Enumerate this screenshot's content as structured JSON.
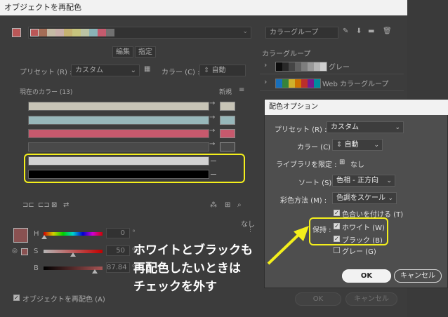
{
  "window": {
    "title": "オブジェクトを再配色"
  },
  "toolbar": {
    "harmony_group_placeholder": "カラーグループ",
    "harmony_colors": [
      "#e36b6b",
      "#c9866a",
      "#f1e3c8",
      "#f7d6cf",
      "#f2d98a",
      "#f3f09a",
      "#e6f0c8",
      "#a9dbe0",
      "#f06f87",
      "#8a8a8a"
    ]
  },
  "tabs": {
    "edit": "編集",
    "assign": "指定"
  },
  "preset": {
    "label": "プリセット (R) :",
    "value": "カスタム"
  },
  "colors_count": {
    "label": "カラー (C) :",
    "value": "自動"
  },
  "current_colors": {
    "header": "現在のカラー (13)",
    "new_header": "新規",
    "rows": [
      {
        "current": "#f3efdf",
        "new": "#f3efdf",
        "has_new": true
      },
      {
        "current": "#b9e0e3",
        "new": "#b9e0e3",
        "has_new": true
      },
      {
        "current": "#f36d86",
        "new": "#f36d86",
        "has_new": true
      },
      {
        "current": "#5a5a5a",
        "new": "#5a5a5a",
        "has_new": true
      },
      {
        "current": "#ffffff",
        "new": "",
        "has_new": false
      },
      {
        "current": "#000000",
        "new": "",
        "has_new": false
      }
    ]
  },
  "sliders": {
    "none_label": "なし",
    "h": {
      "label": "H",
      "value": "0",
      "unit": "°"
    },
    "s": {
      "label": "S",
      "value": "50",
      "unit": "%"
    },
    "b": {
      "label": "B",
      "value": "87.84",
      "unit": "%"
    }
  },
  "color_groups": {
    "title": "カラーグループ",
    "items": [
      {
        "name": "グレー",
        "colors": [
          "#111111",
          "#333333",
          "#555555",
          "#777777",
          "#999999",
          "#bbbbbb",
          "#dddddd",
          "#ffffff"
        ]
      },
      {
        "name": "Web カラーグループ",
        "colors": [
          "#1e88e5",
          "#43a047",
          "#fdd835",
          "#fb8c00",
          "#e53935",
          "#8e24aa",
          "#00acc1"
        ]
      }
    ]
  },
  "footer": {
    "recolor_checkbox": "オブジェクトを再配色 (A)",
    "ok": "OK",
    "cancel": "キャンセル"
  },
  "dialog": {
    "title": "配色オプション",
    "preset_label": "プリセット (R) :",
    "preset_value": "カスタム",
    "colors_label": "カラー (C) :",
    "colors_value": "自動",
    "library_label": "ライブラリを限定 :",
    "library_value": "なし",
    "sort_label": "ソート (S) :",
    "sort_value": "色相 - 正方向",
    "recolor_method_label": "彩色方法 (M) :",
    "recolor_method_value": "色調をスケール",
    "combine_tints_label": "色合いを付ける (T)",
    "preserve_label": "保持 :",
    "preserve_white": "ホワイト (W)",
    "preserve_black": "ブラック (B)",
    "preserve_gray": "グレー (G)",
    "ok": "OK",
    "cancel": "キャンセル"
  },
  "annotation": {
    "line1": "ホワイトとブラックも",
    "line2": "再配色したいときは",
    "line3": "チェックを外す"
  },
  "colors": {
    "highlight": "#f4ef1c"
  }
}
